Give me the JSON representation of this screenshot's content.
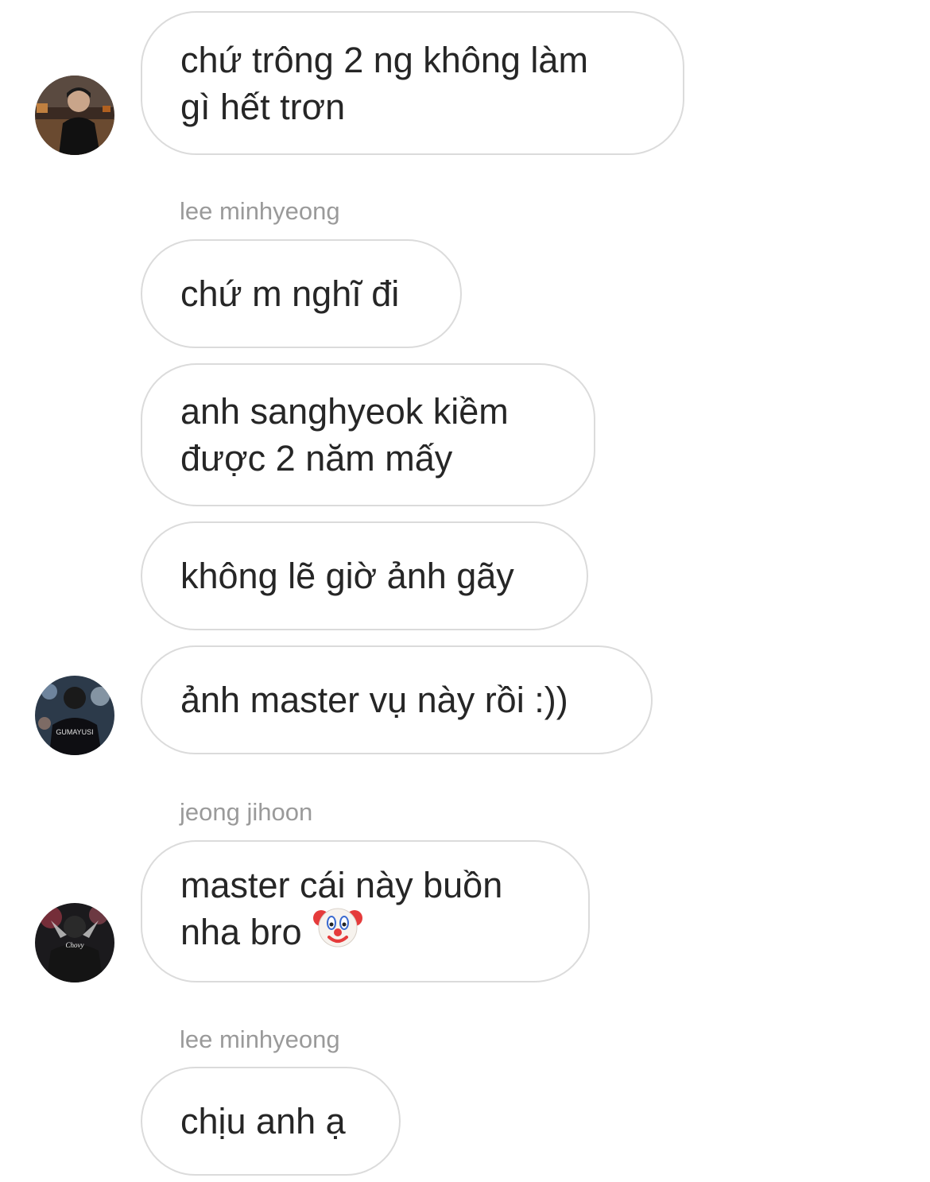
{
  "thread": {
    "messages": [
      {
        "text": "chứ trông 2 ng không làm\ngì hết trơn"
      },
      {
        "sender": "lee minhyeong"
      },
      {
        "text": "chứ m nghĩ đi"
      },
      {
        "text": "anh sanghyeok kiềm\nđược 2 năm mấy"
      },
      {
        "text": "không lẽ giờ ảnh gãy"
      },
      {
        "text": "ảnh master vụ này rồi :))"
      },
      {
        "sender": "jeong jihoon"
      },
      {
        "text": "master cái này buồn\nnha bro",
        "emoji": "clown-face"
      },
      {
        "sender": "lee minhyeong"
      },
      {
        "text": "chịu anh ạ"
      }
    ],
    "avatars": [
      {
        "name": "avatar-user-1",
        "icon": "profile-photo"
      },
      {
        "name": "avatar-user-2",
        "icon": "profile-photo",
        "jersey_text": "GUMAYUSI"
      },
      {
        "name": "avatar-user-3",
        "icon": "profile-photo",
        "jersey_text": "Chovy"
      }
    ]
  },
  "colors": {
    "bubble_border": "#dbdbdb",
    "text": "#262626",
    "sender_text": "#9a9a9a",
    "background": "#ffffff"
  }
}
